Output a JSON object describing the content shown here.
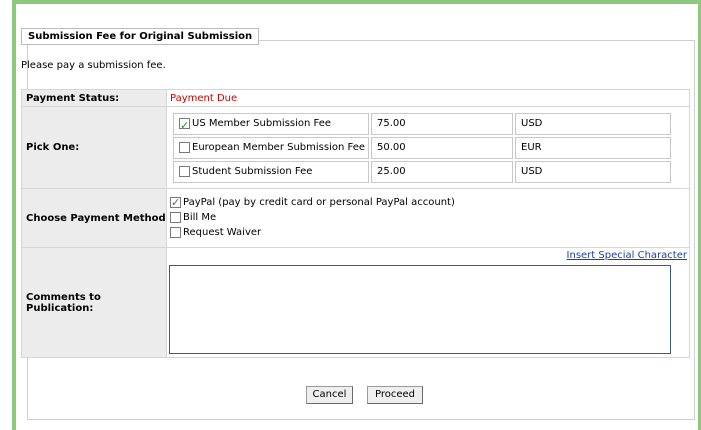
{
  "section": {
    "legend": "Submission Fee for Original Submission",
    "intro": "Please pay a submission fee."
  },
  "payment_status": {
    "label": "Payment Status:",
    "value": "Payment Due",
    "value_color": "#cc0000"
  },
  "pick_one": {
    "label": "Pick One:",
    "options": [
      {
        "name": "US Member Submission Fee",
        "amount": "75.00",
        "currency": "USD",
        "checked": true
      },
      {
        "name": "European Member Submission Fee",
        "amount": "50.00",
        "currency": "EUR",
        "checked": false
      },
      {
        "name": "Student Submission Fee",
        "amount": "25.00",
        "currency": "USD",
        "checked": false
      }
    ]
  },
  "payment_method": {
    "label": "Choose Payment Method",
    "options": [
      {
        "name": "PayPal (pay by credit card or personal PayPal account)",
        "checked": true
      },
      {
        "name": "Bill Me",
        "checked": false
      },
      {
        "name": "Request Waiver",
        "checked": false
      }
    ]
  },
  "comments": {
    "label": "Comments to Publication:",
    "insert_link": "Insert Special Character",
    "value": ""
  },
  "buttons": {
    "cancel": "Cancel",
    "proceed": "Proceed"
  },
  "colors": {
    "frame": "#8cc97c",
    "label_bg": "#ececec",
    "link": "#1a3fa8",
    "check": "#2c8a2c"
  }
}
